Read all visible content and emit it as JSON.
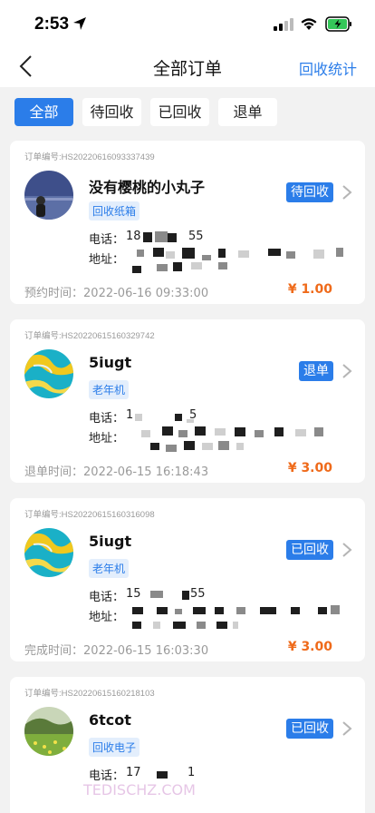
{
  "status_bar": {
    "time": "2:53"
  },
  "nav": {
    "title": "全部订单",
    "action": "回收统计"
  },
  "tabs": [
    {
      "label": "全部",
      "active": true
    },
    {
      "label": "待回收",
      "active": false
    },
    {
      "label": "已回收",
      "active": false
    },
    {
      "label": "退单",
      "active": false
    }
  ],
  "labels": {
    "phone": "电话：",
    "address": "地址："
  },
  "orders": [
    {
      "order_no": "订单编号:HS20220616093337439",
      "nickname": "没有樱桃的小丸子",
      "category": "回收纸箱",
      "status": "待回收",
      "phone_start": "18",
      "phone_end": "55",
      "time_label": "预约时间",
      "time": "2022-06-16 09:33:00",
      "amount": "¥ 1.00",
      "avatar": "night-lake-photo"
    },
    {
      "order_no": "订单编号:HS20220615160329742",
      "nickname": "5iugt",
      "category": "老年机",
      "status": "退单",
      "phone_start": "1",
      "phone_end": "5",
      "time_label": "退单时间",
      "time": "2022-06-15 16:18:43",
      "amount": "¥ 3.00",
      "avatar": "blue-yellow-swirl"
    },
    {
      "order_no": "订单编号:HS20220615160316098",
      "nickname": "5iugt",
      "category": "老年机",
      "status": "已回收",
      "phone_start": "15",
      "phone_end": "55",
      "time_label": "完成时间",
      "time": "2022-06-15 16:03:30",
      "amount": "¥ 3.00",
      "avatar": "blue-yellow-swirl"
    },
    {
      "order_no": "订单编号:HS20220615160218103",
      "nickname": "6tcot",
      "category": "回收电子",
      "status": "已回收",
      "phone_start": "17",
      "phone_end": "1",
      "avatar": "green-field-photo"
    }
  ],
  "watermark": "TEDISCHZ.COM",
  "colors": {
    "accent": "#2b7de9",
    "price": "#ef6a1a",
    "background": "#f2f2f2"
  }
}
